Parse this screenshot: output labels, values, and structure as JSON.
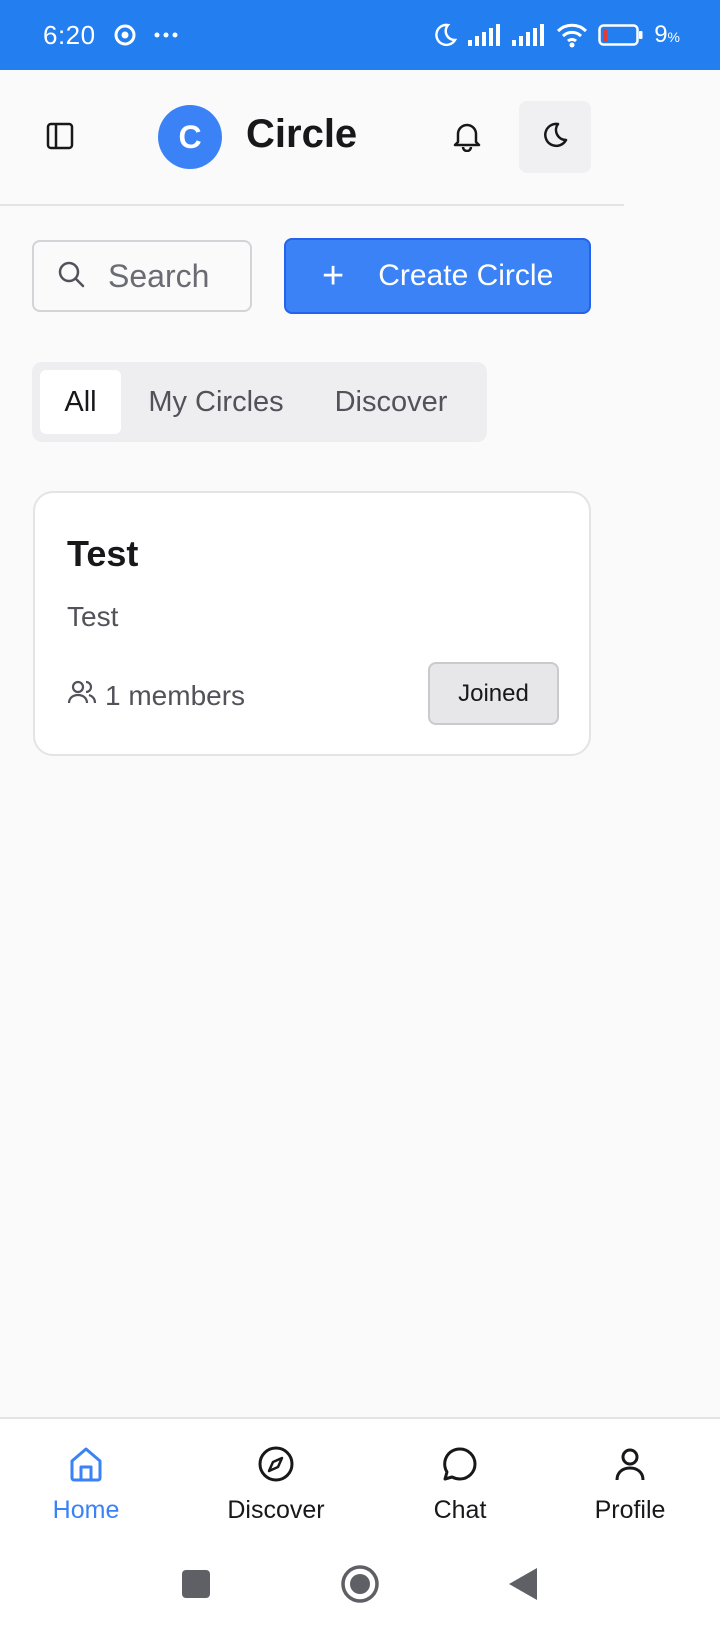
{
  "status_bar": {
    "time": "6:20",
    "battery": "9",
    "battery_unit": "%",
    "bg_color": "#237ef0"
  },
  "header": {
    "logo_letter": "C",
    "title": "Circle",
    "icons": [
      "sidebar-icon",
      "bell-icon",
      "moon-icon"
    ]
  },
  "toolbar": {
    "search_placeholder": "Search",
    "create_label": "Create Circle",
    "create_icon": "plus-icon",
    "accent_color": "#3b82f6"
  },
  "tabs": [
    {
      "label": "All",
      "active": true
    },
    {
      "label": "My Circles",
      "active": false
    },
    {
      "label": "Discover",
      "active": false
    }
  ],
  "circles": [
    {
      "name": "Test",
      "description": "Test",
      "members": "1 members",
      "status_label": "Joined"
    }
  ],
  "bottom_nav": [
    {
      "label": "Home",
      "icon": "home-icon",
      "active": true
    },
    {
      "label": "Discover",
      "icon": "compass-icon",
      "active": false
    },
    {
      "label": "Chat",
      "icon": "chat-icon",
      "active": false
    },
    {
      "label": "Profile",
      "icon": "user-icon",
      "active": false
    }
  ],
  "system_nav": [
    "recents-icon",
    "home-circle-icon",
    "back-icon"
  ]
}
